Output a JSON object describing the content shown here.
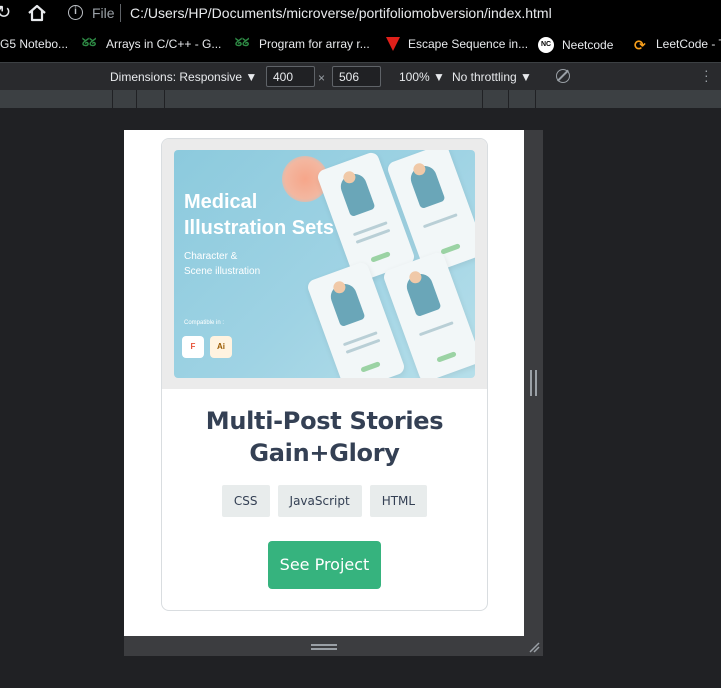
{
  "browser": {
    "file_label": "File",
    "url": "C:/Users/HP/Documents/microverse/portifoliomobversion/index.html"
  },
  "bookmarks": [
    {
      "label": "G5 Notebo...",
      "icon": "none"
    },
    {
      "label": "Arrays in C/C++ - G...",
      "icon": "gfg-icon"
    },
    {
      "label": "Program for array r...",
      "icon": "gfg-icon"
    },
    {
      "label": "Escape Sequence in...",
      "icon": "escape-icon"
    },
    {
      "label": "Neetcode",
      "icon": "neetcode-icon"
    },
    {
      "label": "LeetCode - T",
      "icon": "leetcode-icon"
    }
  ],
  "devtools": {
    "dimensions_label": "Dimensions: Responsive ▼",
    "width": "400",
    "times": "×",
    "height": "506",
    "zoom": "100% ▼",
    "throttling": "No throttling ▼"
  },
  "card": {
    "image": {
      "title": "Medical Illustration Sets",
      "subtitle_line1": "Character &",
      "subtitle_line2": "Scene illustration",
      "compatible": "Compatible in :",
      "tool1": "F",
      "tool2": "Ai"
    },
    "title": "Multi-Post Stories Gain+Glory",
    "tags": [
      "CSS",
      "JavaScript",
      "HTML"
    ],
    "button": "See Project"
  },
  "colors": {
    "accent": "#36b37e",
    "title_text": "#344054",
    "tag_bg": "#e8ecec"
  }
}
